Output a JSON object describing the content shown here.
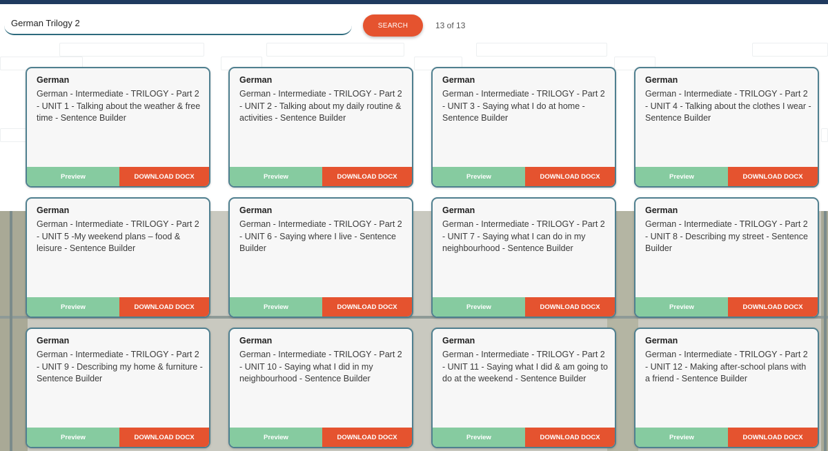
{
  "search": {
    "value": "German Trilogy 2",
    "button_label": "SEARCH",
    "result_count": "13 of 13"
  },
  "colors": {
    "accent": "#e5532f",
    "preview": "#86cba0",
    "card_border": "#4f7f8f",
    "top_bar": "#1f3a5f"
  },
  "cards": [
    {
      "title": "German",
      "description": "German - Intermediate - TRILOGY - Part 2 - UNIT 1 - Talking about the weather & free time - Sentence Builder",
      "preview_label": "Preview",
      "download_label": "DOWNLOAD DOCX"
    },
    {
      "title": "German",
      "description": "German - Intermediate - TRILOGY - Part 2 - UNIT 2 - Talking about my daily routine & activities - Sentence Builder",
      "preview_label": "Preview",
      "download_label": "DOWNLOAD DOCX"
    },
    {
      "title": "German",
      "description": "German - Intermediate - TRILOGY - Part 2 - UNIT 3 - Saying what I do at home - Sentence Builder",
      "preview_label": "Preview",
      "download_label": "DOWNLOAD DOCX"
    },
    {
      "title": "German",
      "description": "German - Intermediate - TRILOGY - Part 2 - UNIT 4 - Talking about the clothes I wear - Sentence Builder",
      "preview_label": "Preview",
      "download_label": "DOWNLOAD DOCX"
    },
    {
      "title": "German",
      "description": "German - Intermediate - TRILOGY - Part 2 - UNIT 5 -My weekend plans – food & leisure - Sentence Builder",
      "preview_label": "Preview",
      "download_label": "DOWNLOAD DOCX"
    },
    {
      "title": "German",
      "description": "German - Intermediate - TRILOGY - Part 2 - UNIT 6 - Saying where I live - Sentence Builder",
      "preview_label": "Preview",
      "download_label": "DOWNLOAD DOCX"
    },
    {
      "title": "German",
      "description": "German - Intermediate - TRILOGY - Part 2 - UNIT 7 - Saying what I can do in my neighbourhood - Sentence Builder",
      "preview_label": "Preview",
      "download_label": "DOWNLOAD DOCX"
    },
    {
      "title": "German",
      "description": "German - Intermediate - TRILOGY - Part 2 - UNIT 8 - Describing my street - Sentence Builder",
      "preview_label": "Preview",
      "download_label": "DOWNLOAD DOCX"
    },
    {
      "title": "German",
      "description": "German - Intermediate - TRILOGY - Part 2 - UNIT 9 - Describing my home & furniture - Sentence Builder",
      "preview_label": "Preview",
      "download_label": "DOWNLOAD DOCX"
    },
    {
      "title": "German",
      "description": "German - Intermediate - TRILOGY - Part 2 - UNIT 10 - Saying what I did in my neighbourhood - Sentence Builder",
      "preview_label": "Preview",
      "download_label": "DOWNLOAD DOCX"
    },
    {
      "title": "German",
      "description": "German - Intermediate - TRILOGY - Part 2 - UNIT 11 - Saying what I did & am going to do at the weekend - Sentence Builder",
      "preview_label": "Preview",
      "download_label": "DOWNLOAD DOCX"
    },
    {
      "title": "German",
      "description": "German - Intermediate - TRILOGY - Part 2 - UNIT 12 - Making after-school plans with a friend - Sentence Builder",
      "preview_label": "Preview",
      "download_label": "DOWNLOAD DOCX"
    }
  ]
}
